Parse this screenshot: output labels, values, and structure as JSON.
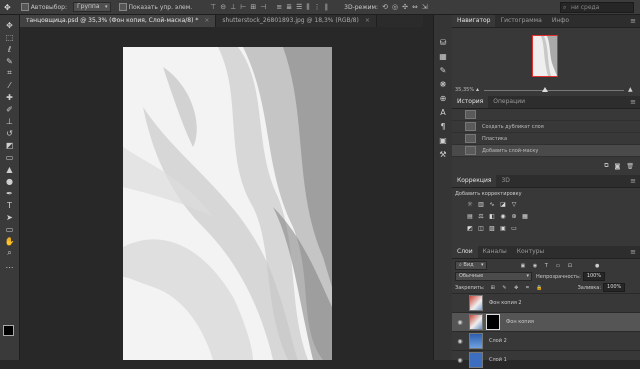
{
  "optionsbar": {
    "autoselect_label": "Автовыбор:",
    "autoselect_value": "Группа",
    "show_controls_label": "Показать упр. элем.",
    "threed_label": "3D-режим:",
    "search_placeholder": "ни среда"
  },
  "tabs": [
    {
      "label": "танцовщица.psd @ 35,3% (Фон копия, Слой-маска/8) *"
    },
    {
      "label": "shutterstock_26801893.jpg @ 18,3% (RGB/8)"
    }
  ],
  "navigator": {
    "tabs": [
      "Навигатор",
      "Гистограмма",
      "Инфо"
    ],
    "zoom": "35,35%"
  },
  "history": {
    "tabs": [
      "История",
      "Операции"
    ],
    "items": [
      {
        "label": ""
      },
      {
        "label": "Создать дубликат слоя"
      },
      {
        "label": "Пластика"
      },
      {
        "label": "Добавить слой-маску"
      }
    ]
  },
  "corrections": {
    "tabs": [
      "Коррекция",
      "3D"
    ],
    "label": "Добавить корректировку"
  },
  "layers": {
    "tabs": [
      "Слои",
      "Каналы",
      "Контуры"
    ],
    "kind_label": "Вид",
    "blend_mode": "Обычные",
    "opacity_label": "Непрозрачность:",
    "opacity_value": "100%",
    "lock_label": "Закрепить:",
    "fill_label": "Заливка:",
    "fill_value": "100%",
    "rows": [
      {
        "name": "Фон копия 2"
      },
      {
        "name": "Фон копия"
      },
      {
        "name": "Слой 2"
      },
      {
        "name": "Слой 1"
      }
    ]
  },
  "colors": {
    "nav_frame": "#e03030",
    "selected_row": "#555555"
  }
}
